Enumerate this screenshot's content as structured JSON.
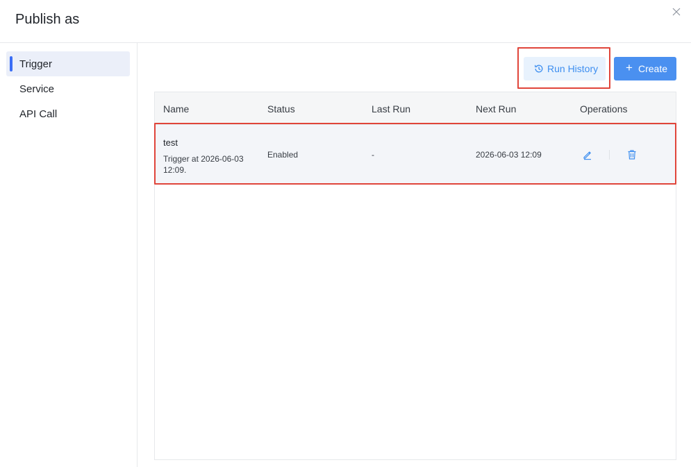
{
  "dialog": {
    "title": "Publish as",
    "close_icon": "close-icon"
  },
  "sidebar": {
    "items": [
      {
        "label": "Trigger",
        "active": true
      },
      {
        "label": "Service",
        "active": false
      },
      {
        "label": "API Call",
        "active": false
      }
    ]
  },
  "toolbar": {
    "run_history_label": "Run History",
    "run_history_icon": "history-icon",
    "create_label": "Create",
    "create_icon": "plus-icon"
  },
  "table": {
    "columns": [
      "Name",
      "Status",
      "Last Run",
      "Next Run",
      "Operations"
    ],
    "rows": [
      {
        "name": "test",
        "description": "Trigger at 2026-06-03 12:09.",
        "status": "Enabled",
        "last_run": "-",
        "next_run": "2026-06-03 12:09",
        "operations": [
          "edit-icon",
          "delete-icon"
        ]
      }
    ]
  },
  "colors": {
    "accent": "#4a90f0",
    "highlight": "#e0453a",
    "active_nav": "#ebeff9"
  }
}
